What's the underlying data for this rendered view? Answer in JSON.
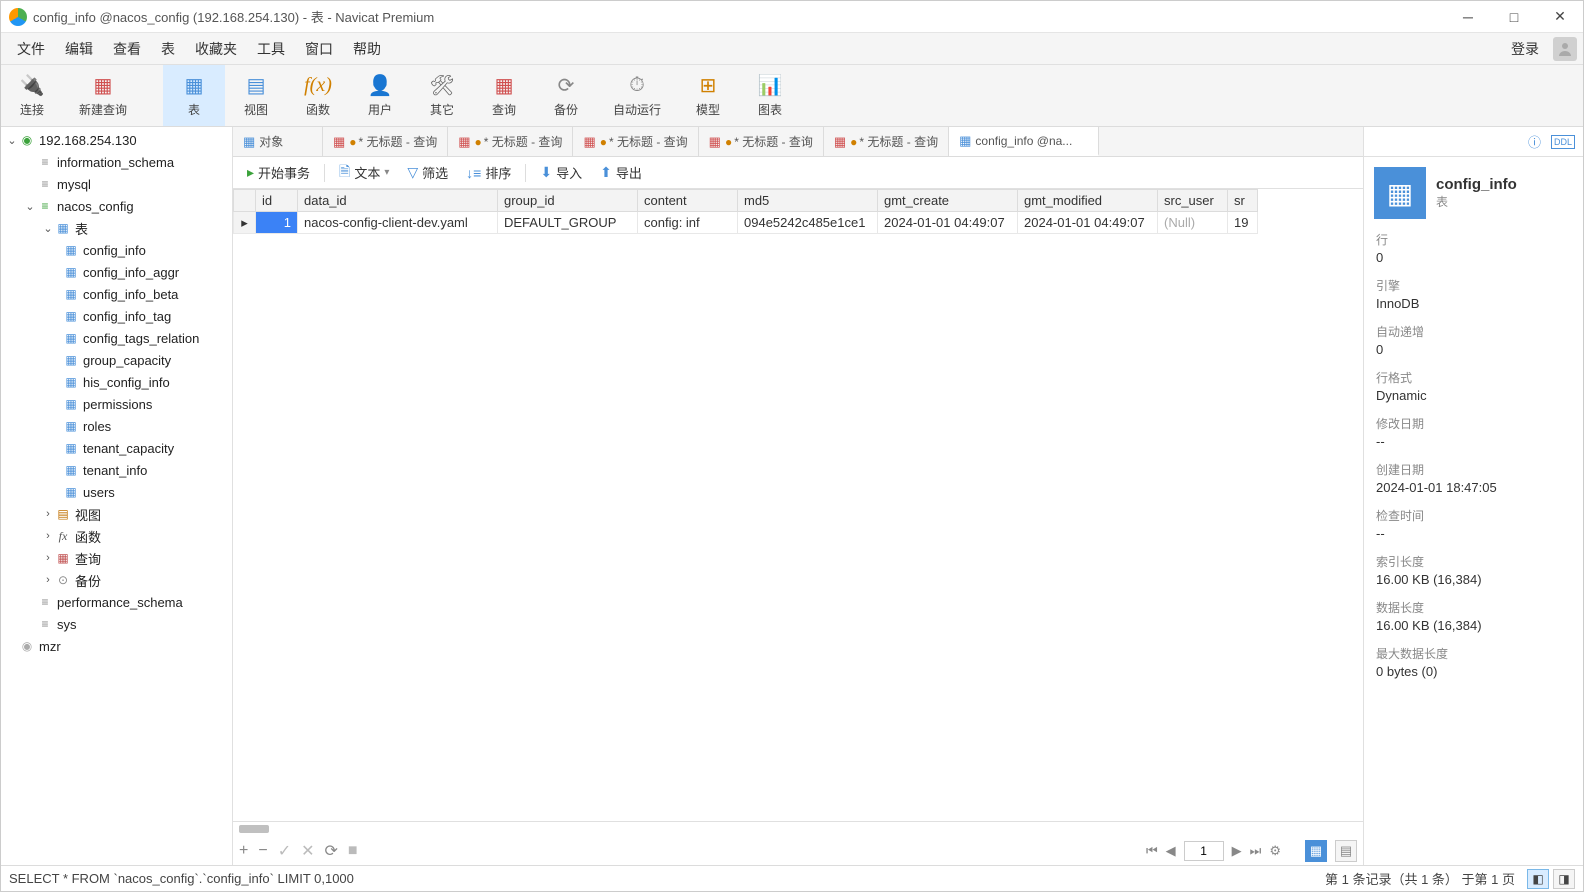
{
  "title": "config_info @nacos_config (192.168.254.130) - 表 - Navicat Premium",
  "menu": [
    "文件",
    "编辑",
    "查看",
    "表",
    "收藏夹",
    "工具",
    "窗口",
    "帮助"
  ],
  "login_label": "登录",
  "toolbar": [
    {
      "label": "连接",
      "active": false
    },
    {
      "label": "新建查询",
      "active": false
    },
    {
      "label": "表",
      "active": true
    },
    {
      "label": "视图",
      "active": false
    },
    {
      "label": "函数",
      "active": false
    },
    {
      "label": "用户",
      "active": false
    },
    {
      "label": "其它",
      "active": false
    },
    {
      "label": "查询",
      "active": false
    },
    {
      "label": "备份",
      "active": false
    },
    {
      "label": "自动运行",
      "active": false
    },
    {
      "label": "模型",
      "active": false
    },
    {
      "label": "图表",
      "active": false
    }
  ],
  "sidebar": {
    "server": "192.168.254.130",
    "dbs": [
      {
        "name": "information_schema"
      },
      {
        "name": "mysql"
      },
      {
        "name": "nacos_config",
        "expanded": true,
        "active": true,
        "children": {
          "tables_label": "表",
          "tables": [
            "config_info",
            "config_info_aggr",
            "config_info_beta",
            "config_info_tag",
            "config_tags_relation",
            "group_capacity",
            "his_config_info",
            "permissions",
            "roles",
            "tenant_capacity",
            "tenant_info",
            "users"
          ],
          "views": "视图",
          "functions": "函数",
          "queries": "查询",
          "backup": "备份"
        }
      },
      {
        "name": "performance_schema"
      },
      {
        "name": "sys"
      }
    ],
    "other_conn": "mzr"
  },
  "tabs": [
    {
      "label": "对象",
      "icon": "grid"
    },
    {
      "label": "* 无标题 - 查询",
      "icon": "query",
      "dirty": true
    },
    {
      "label": "* 无标题 - 查询",
      "icon": "query",
      "dirty": true
    },
    {
      "label": "* 无标题 - 查询",
      "icon": "query",
      "dirty": true
    },
    {
      "label": "* 无标题 - 查询",
      "icon": "query",
      "dirty": true
    },
    {
      "label": "* 无标题 - 查询",
      "icon": "query",
      "dirty": true
    },
    {
      "label": "config_info @na...",
      "icon": "table",
      "active": true
    }
  ],
  "subtoolbar": {
    "start": "开始事务",
    "text": "文本",
    "filter": "筛选",
    "sort": "排序",
    "import": "导入",
    "export": "导出"
  },
  "columns": [
    "id",
    "data_id",
    "group_id",
    "content",
    "md5",
    "gmt_create",
    "gmt_modified",
    "src_user",
    "sr"
  ],
  "rows": [
    {
      "id": "1",
      "data_id": "nacos-config-client-dev.yaml",
      "group_id": "DEFAULT_GROUP",
      "content": "config:    inf",
      "md5": "094e5242c485e1ce1",
      "gmt_create": "2024-01-01 04:49:07",
      "gmt_modified": "2024-01-01 04:49:07",
      "src_user": "(Null)",
      "sr": "19"
    }
  ],
  "grid_nav": {
    "page": "1"
  },
  "statusbar": {
    "sql": "SELECT * FROM `nacos_config`.`config_info` LIMIT 0,1000",
    "info": "第 1 条记录（共 1 条） 于第 1 页"
  },
  "right": {
    "name": "config_info",
    "type": "表",
    "fields": [
      {
        "l": "行",
        "v": "0"
      },
      {
        "l": "引擎",
        "v": "InnoDB"
      },
      {
        "l": "自动递增",
        "v": "0"
      },
      {
        "l": "行格式",
        "v": "Dynamic"
      },
      {
        "l": "修改日期",
        "v": "--"
      },
      {
        "l": "创建日期",
        "v": "2024-01-01 18:47:05"
      },
      {
        "l": "检查时间",
        "v": "--"
      },
      {
        "l": "索引长度",
        "v": "16.00 KB (16,384)"
      },
      {
        "l": "数据长度",
        "v": "16.00 KB (16,384)"
      },
      {
        "l": "最大数据长度",
        "v": "0 bytes (0)"
      }
    ]
  }
}
